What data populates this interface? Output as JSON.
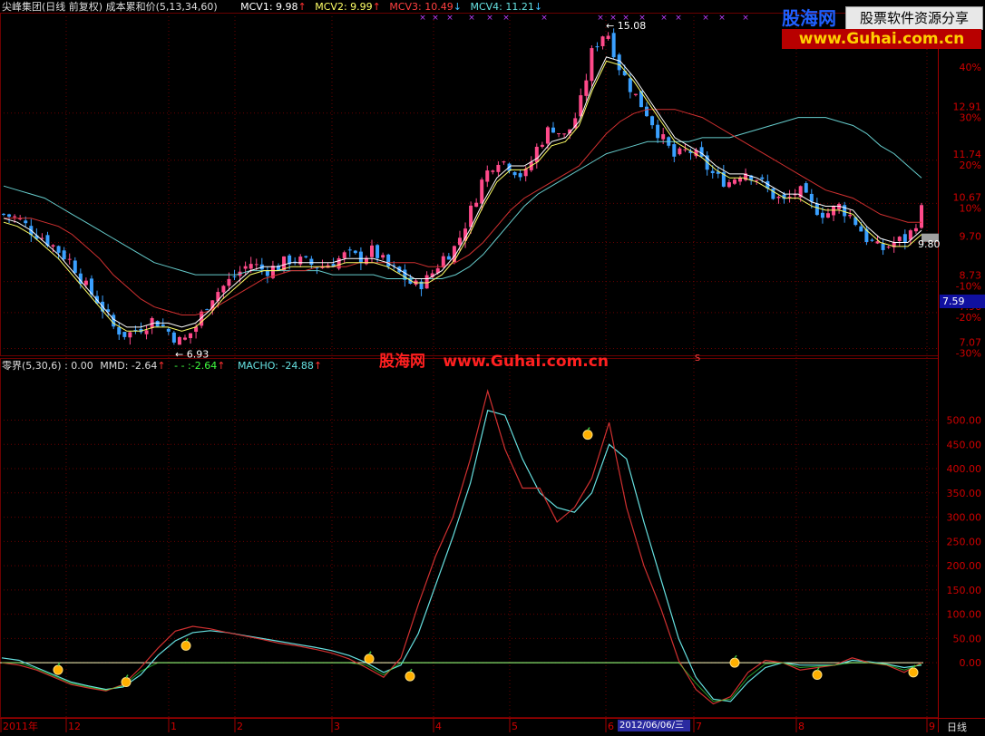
{
  "header": {
    "stock_title": "尖峰集团(日线 前复权) 成本累和价(5,13,34,60)",
    "mcv1": "MCV1: 9.98",
    "mcv2": "MCV2: 9.99",
    "mcv3": "MCV3: 10.49",
    "mcv4": "MCV4: 11.21"
  },
  "indicator_header": {
    "name": "零界(5,30,6) : 0.00",
    "mmd": "MMD: -2.64",
    "mid": "-2.64",
    "macho": "MACHO: -24.88"
  },
  "watermark": {
    "logo_text": "股海网",
    "slogan": "股票软件资源分享",
    "url": "www.Guhai.com.cn",
    "center_logo": "股海网",
    "center_url": "www.Guhai.com.cn"
  },
  "price_labels": {
    "high": "15.08",
    "low": "6.93",
    "last": "9.80",
    "current_box": "7.59",
    "marker_s": "S"
  },
  "colors": {
    "background": "#000000",
    "grid": "#6a0000",
    "axis_text": "#d00000",
    "up_candle": "#ff4a8a",
    "down_candle": "#3aa0ff",
    "mcv1": "#ffffff",
    "mcv2": "#ffff66",
    "mcv3": "#d03030",
    "mcv4": "#66cccc",
    "macho": "#66e0e0",
    "mmd": "#d03030",
    "signal_dot": "#ffb000"
  },
  "time_axis": {
    "labels": [
      "2011年",
      "12",
      "1",
      "2",
      "3",
      "4",
      "5",
      "6",
      "7",
      "8",
      "9"
    ],
    "cursor_date": "2012/06/06/三",
    "period": "日线"
  },
  "chart_data": [
    {
      "type": "candlestick",
      "title": "尖峰集团(日线 前复权) 成本累和价(5,13,34,60)",
      "y_ticks": [
        {
          "price": 12.91,
          "pct": "30%"
        },
        {
          "price": 11.74,
          "pct": "20%"
        },
        {
          "price": 10.67,
          "pct": "10%"
        },
        {
          "price": 9.7,
          "pct": ""
        },
        {
          "price": 8.73,
          "pct": "-10%"
        },
        {
          "price": 7.96,
          "pct": "-20%"
        },
        {
          "price": 7.07,
          "pct": "-30%"
        }
      ],
      "top_pct_label": "40%",
      "ylim": [
        6.9,
        15.4
      ],
      "series_names": [
        "MCV1",
        "MCV2",
        "MCV3",
        "MCV4"
      ],
      "annotated_high": 15.08,
      "annotated_low": 6.93,
      "last_close": 9.8,
      "close_path": [
        10.4,
        10.3,
        10.0,
        9.8,
        9.5,
        9.2,
        8.6,
        8.2,
        7.6,
        7.4,
        7.6,
        7.8,
        7.5,
        7.2,
        7.6,
        8.3,
        8.6,
        8.9,
        9.2,
        9.0,
        9.1,
        9.3,
        9.2,
        9.1,
        9.2,
        9.4,
        9.3,
        9.5,
        9.1,
        8.9,
        8.6,
        8.8,
        9.3,
        9.6,
        10.4,
        11.3,
        11.8,
        11.6,
        11.3,
        12.1,
        12.6,
        12.3,
        13.0,
        14.5,
        15.0,
        14.0,
        13.4,
        12.9,
        12.3,
        11.8,
        12.0,
        11.7,
        11.3,
        11.2,
        11.5,
        11.3,
        10.9,
        10.7,
        11.0,
        10.6,
        10.4,
        10.6,
        10.3,
        9.8,
        9.5,
        9.7,
        9.8,
        10.5
      ],
      "mcv1_path": [
        10.3,
        10.2,
        10.0,
        9.7,
        9.4,
        9.0,
        8.6,
        8.2,
        7.8,
        7.6,
        7.6,
        7.7,
        7.7,
        7.6,
        7.7,
        8.0,
        8.4,
        8.7,
        9.0,
        9.1,
        9.1,
        9.2,
        9.2,
        9.2,
        9.2,
        9.3,
        9.3,
        9.3,
        9.2,
        9.0,
        8.8,
        8.8,
        9.0,
        9.4,
        10.0,
        10.7,
        11.3,
        11.6,
        11.6,
        11.8,
        12.2,
        12.3,
        12.7,
        13.6,
        14.3,
        14.2,
        13.8,
        13.3,
        12.8,
        12.3,
        12.1,
        11.9,
        11.6,
        11.4,
        11.4,
        11.3,
        11.1,
        10.9,
        10.9,
        10.7,
        10.6,
        10.6,
        10.5,
        10.1,
        9.8,
        9.7,
        9.7,
        10.0
      ],
      "mcv3_path": [
        10.3,
        10.3,
        10.3,
        10.2,
        10.1,
        9.9,
        9.6,
        9.3,
        8.9,
        8.6,
        8.3,
        8.1,
        8.0,
        7.9,
        7.9,
        8.0,
        8.2,
        8.4,
        8.6,
        8.8,
        8.9,
        9.0,
        9.0,
        9.1,
        9.1,
        9.1,
        9.2,
        9.2,
        9.2,
        9.2,
        9.2,
        9.1,
        9.1,
        9.2,
        9.4,
        9.7,
        10.1,
        10.5,
        10.8,
        11.0,
        11.2,
        11.4,
        11.6,
        12.0,
        12.4,
        12.7,
        12.9,
        13.0,
        13.0,
        13.0,
        12.9,
        12.8,
        12.6,
        12.4,
        12.2,
        12.0,
        11.8,
        11.6,
        11.4,
        11.2,
        11.0,
        10.9,
        10.8,
        10.6,
        10.4,
        10.3,
        10.2,
        10.2
      ],
      "mcv4_path": [
        11.1,
        11.0,
        10.9,
        10.8,
        10.6,
        10.4,
        10.2,
        10.0,
        9.8,
        9.6,
        9.4,
        9.2,
        9.1,
        9.0,
        8.9,
        8.9,
        8.9,
        8.9,
        9.0,
        9.0,
        9.0,
        9.0,
        9.0,
        9.0,
        8.9,
        8.9,
        8.9,
        8.9,
        8.8,
        8.8,
        8.8,
        8.8,
        8.8,
        8.9,
        9.1,
        9.4,
        9.8,
        10.2,
        10.6,
        10.9,
        11.1,
        11.3,
        11.5,
        11.7,
        11.9,
        12.0,
        12.1,
        12.2,
        12.2,
        12.2,
        12.2,
        12.3,
        12.3,
        12.3,
        12.4,
        12.5,
        12.6,
        12.7,
        12.8,
        12.8,
        12.8,
        12.7,
        12.6,
        12.4,
        12.1,
        11.9,
        11.6,
        11.3
      ]
    },
    {
      "type": "line",
      "title": "零界(5,30,6)",
      "y_ticks": [
        500,
        450,
        400,
        350,
        300,
        250,
        200,
        150,
        100,
        50,
        0
      ],
      "ylim": [
        -110,
        600
      ],
      "series": [
        {
          "name": "MMD",
          "values": [
            0,
            -5,
            -15,
            -30,
            -45,
            -52,
            -58,
            -45,
            -10,
            30,
            65,
            75,
            70,
            62,
            55,
            48,
            40,
            35,
            28,
            20,
            8,
            -10,
            -30,
            10,
            120,
            220,
            300,
            420,
            560,
            440,
            360,
            360,
            290,
            320,
            380,
            495,
            320,
            200,
            110,
            5,
            -55,
            -85,
            -70,
            -20,
            5,
            0,
            -15,
            -10,
            -5,
            10,
            0,
            -5,
            -20,
            0
          ]
        },
        {
          "name": "MACHO",
          "values": [
            10,
            5,
            -10,
            -25,
            -40,
            -48,
            -55,
            -50,
            -25,
            15,
            45,
            62,
            66,
            62,
            56,
            50,
            44,
            38,
            32,
            25,
            15,
            0,
            -20,
            -5,
            60,
            160,
            260,
            370,
            520,
            510,
            420,
            350,
            320,
            310,
            350,
            450,
            420,
            290,
            170,
            50,
            -30,
            -75,
            -80,
            -40,
            -10,
            0,
            -5,
            -5,
            -5,
            5,
            2,
            -3,
            -10,
            -5
          ]
        }
      ],
      "signal_values": [
        -15,
        -40,
        35,
        8,
        -28,
        470,
        0,
        -25,
        -20
      ]
    }
  ]
}
